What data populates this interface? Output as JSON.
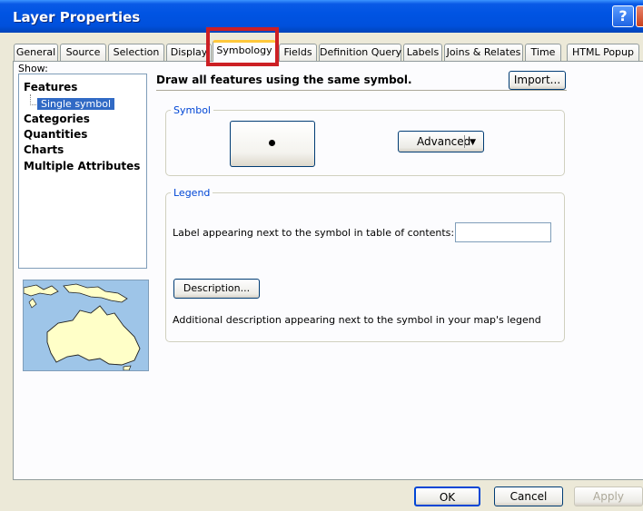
{
  "window": {
    "title": "Layer Properties",
    "help_glyph": "?",
    "close_glyph": "✕"
  },
  "tabs": [
    {
      "label": "General"
    },
    {
      "label": "Source"
    },
    {
      "label": "Selection"
    },
    {
      "label": "Display"
    },
    {
      "label": "Symbology",
      "active": true
    },
    {
      "label": "Fields"
    },
    {
      "label": "Definition Query"
    },
    {
      "label": "Labels"
    },
    {
      "label": "Joins & Relates"
    },
    {
      "label": "Time"
    },
    {
      "label": "HTML Popup"
    }
  ],
  "show": {
    "label": "Show:",
    "items": [
      {
        "label": "Features"
      },
      {
        "label": "Single symbol",
        "selected": true
      },
      {
        "label": "Categories"
      },
      {
        "label": "Quantities"
      },
      {
        "label": "Charts"
      },
      {
        "label": "Multiple Attributes"
      }
    ]
  },
  "main": {
    "heading": "Draw all features using the same symbol.",
    "import_label": "Import...",
    "symbol_group": "Symbol",
    "advanced_label": "Advanced",
    "legend_group": "Legend",
    "legend_label": "Label appearing next to the symbol in table of contents:",
    "legend_value": "",
    "description_label": "Description...",
    "description_text": "Additional description appearing next to the symbol in your map's legend"
  },
  "footer": {
    "ok": "OK",
    "cancel": "Cancel",
    "apply": "Apply"
  },
  "colors": {
    "highlight": "#cc1f24",
    "selection": "#316ac5",
    "titlebar": "#0054e3"
  }
}
